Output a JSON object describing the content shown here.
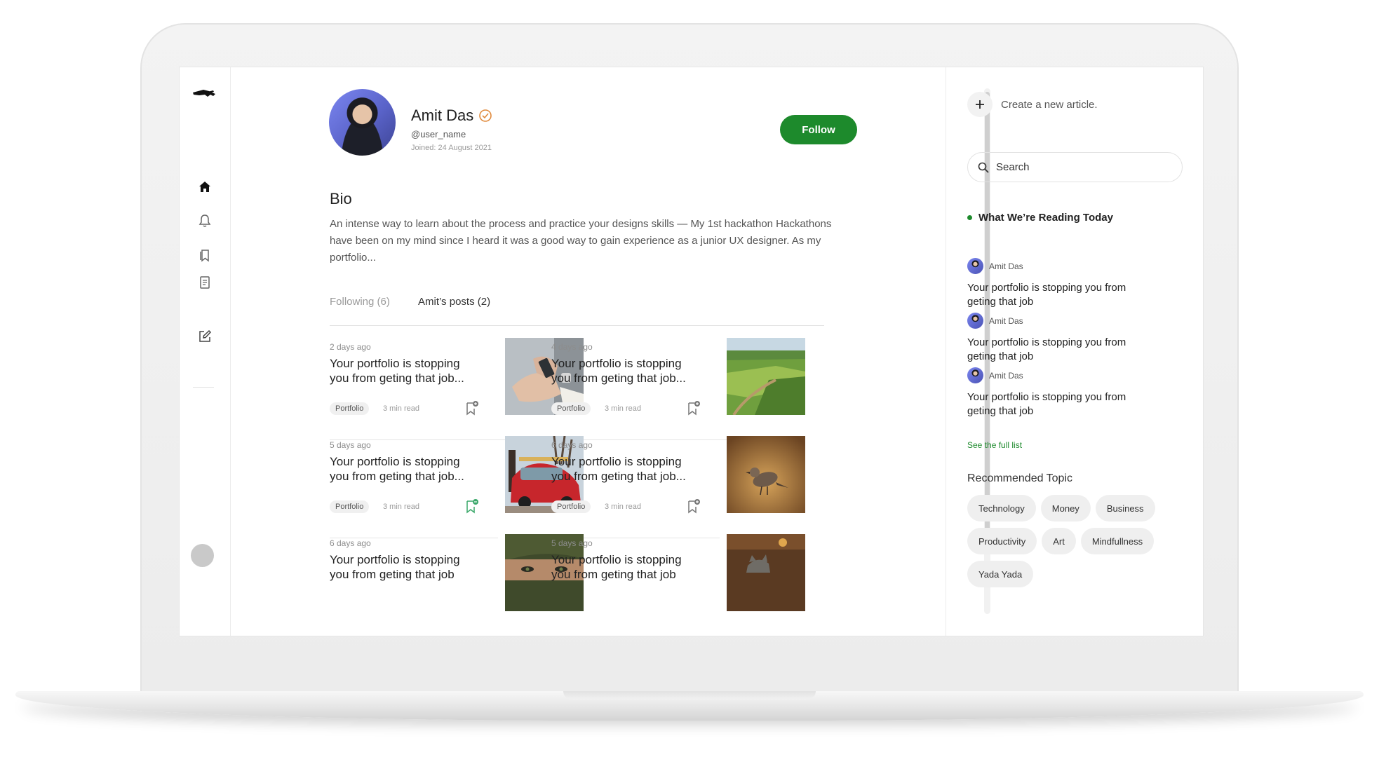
{
  "profile": {
    "name": "Amit Das",
    "handle": "@user_name",
    "joined": "Joined: 24 August 2021",
    "follow_label": "Follow"
  },
  "bio": {
    "title": "Bio",
    "text": "An intense way to learn about the process and practice your designs skills — My 1st hackathon Hackathons have been on my mind since I heard it was a good way to gain experience as a junior UX designer. As my portfolio..."
  },
  "tabs": [
    {
      "label": "Following (6)"
    },
    {
      "label": "Amit’s posts (2)"
    }
  ],
  "posts": [
    {
      "time": "2 days ago",
      "title": "Your portfolio is stopping you from geting that job...",
      "tag": "Portfolio",
      "read": "3 min read",
      "image": "hands-phone"
    },
    {
      "time": "4 days ago",
      "title": "Your portfolio is stopping you from geting that job...",
      "tag": "Portfolio",
      "read": "3 min read",
      "image": "farmland"
    },
    {
      "time": "5 days ago",
      "title": "Your portfolio is stopping you from geting that job...",
      "tag": "Portfolio",
      "read": "3 min read",
      "image": "red-car"
    },
    {
      "time": "6 days ago",
      "title": "Your portfolio is stopping you from geting that job...",
      "tag": "Portfolio",
      "read": "3 min read",
      "image": "bird"
    },
    {
      "time": "6 days ago",
      "title": "Your portfolio is stopping you from geting that job",
      "tag": "",
      "read": "",
      "image": "eyes"
    },
    {
      "time": "5 days ago",
      "title": "Your portfolio is stopping you from geting that job",
      "tag": "",
      "read": "",
      "image": "cat"
    }
  ],
  "right": {
    "create_label": "Create a new article.",
    "search_placeholder": "Search",
    "reading_title": "What We’re Reading Today",
    "reading": [
      {
        "author": "Amit Das",
        "title": "Your portfolio is stopping you from geting that job"
      },
      {
        "author": "Amit Das",
        "title": "Your portfolio is stopping you from geting that job"
      },
      {
        "author": "Amit Das",
        "title": "Your portfolio is stopping you from geting that job"
      }
    ],
    "see_full": "See the full list",
    "recommended_title": "Recommended Topic",
    "topics": [
      "Technology",
      "Money",
      "Business",
      "Productivity",
      "Art",
      "Mindfullness",
      "Yada Yada"
    ]
  },
  "colors": {
    "accent": "#1d8a2c",
    "verified": "#e08a3c"
  }
}
